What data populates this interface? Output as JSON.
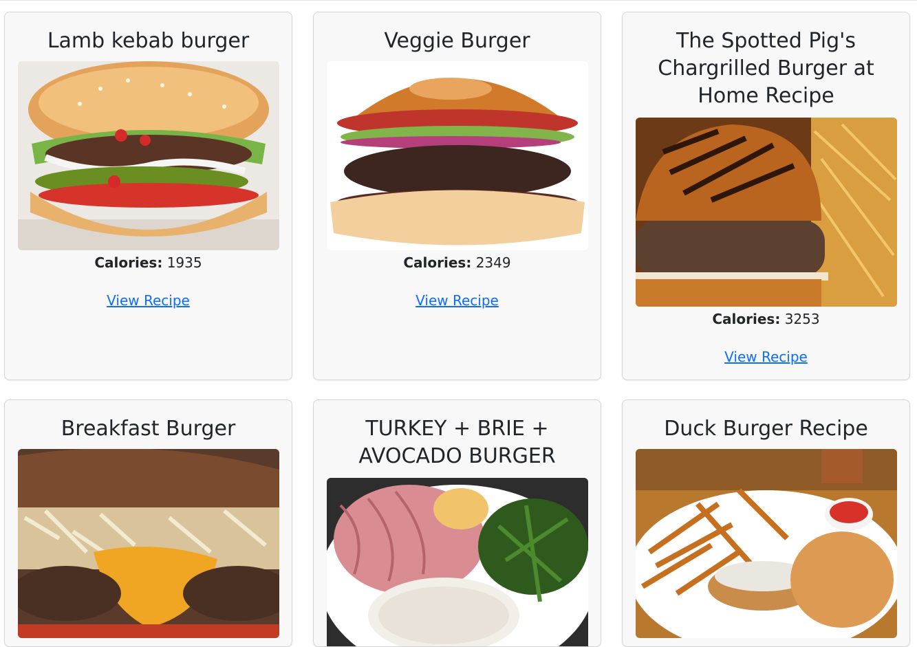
{
  "recipes": [
    {
      "title": "Lamb kebab burger",
      "calories_label": "Calories:",
      "calories": "1935",
      "link": "View Recipe",
      "image": "burger-photo"
    },
    {
      "title": "Veggie Burger",
      "calories_label": "Calories:",
      "calories": "2349",
      "link": "View Recipe",
      "image": "burger-photo"
    },
    {
      "title": "The Spotted Pig's Chargrilled Burger at Home Recipe",
      "calories_label": "Calories:",
      "calories": "3253",
      "link": "View Recipe",
      "image": "burger-with-fries-photo"
    },
    {
      "title": "Breakfast Burger",
      "image": "burger-photo"
    },
    {
      "title": "TURKEY + BRIE + AVOCADO BURGER",
      "image": "ingredients-bowl-photo"
    },
    {
      "title": "Duck Burger Recipe",
      "image": "burger-plate-photo"
    }
  ]
}
